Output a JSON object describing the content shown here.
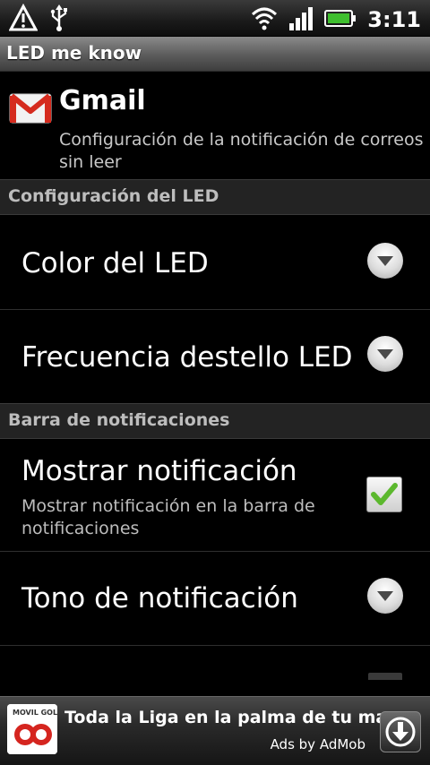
{
  "status_bar": {
    "time": "3:11",
    "icons": [
      "warning-icon",
      "usb-icon",
      "wifi-icon",
      "signal-icon",
      "battery-icon"
    ]
  },
  "title_bar": {
    "title": "LED me know"
  },
  "header": {
    "icon": "gmail-icon",
    "title": "Gmail",
    "subtitle": "Configuración de la notificación de correos sin leer"
  },
  "sections": [
    {
      "label": "Configuración del LED",
      "items": [
        {
          "title": "Color del LED",
          "control": "dropdown"
        },
        {
          "title": "Frecuencia destello LED",
          "control": "dropdown"
        }
      ]
    },
    {
      "label": "Barra de notificaciones",
      "items": [
        {
          "title": "Mostrar notificación",
          "subtitle": "Mostrar notificación en la barra de notificaciones",
          "control": "checkbox",
          "checked": true
        },
        {
          "title": "Tono de notificación",
          "control": "dropdown"
        }
      ]
    }
  ],
  "ad": {
    "logo_text": "MOVIL GOL",
    "text": "Toda la Liga en la palma de tu mano",
    "by": "Ads by AdMob",
    "download_icon": "download-icon"
  },
  "colors": {
    "background": "#000000",
    "section_bg": "#232323",
    "checkmark": "#5cb82e",
    "gmail_red": "#d52b1e"
  }
}
